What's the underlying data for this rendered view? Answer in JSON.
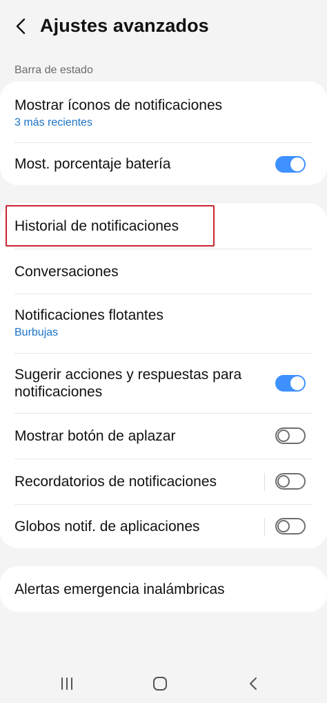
{
  "header": {
    "title": "Ajustes avanzados",
    "back_icon": "chevron-left-icon"
  },
  "status_bar_section": {
    "label": "Barra de estado",
    "items": [
      {
        "title": "Mostrar íconos de notificaciones",
        "subtitle": "3 más recientes"
      },
      {
        "title": "Most. porcentaje batería",
        "toggle": true
      }
    ]
  },
  "notifications_section": {
    "items": [
      {
        "title": "Historial de notificaciones",
        "highlighted": true
      },
      {
        "title": "Conversaciones"
      },
      {
        "title": "Notificaciones flotantes",
        "subtitle": "Burbujas"
      },
      {
        "title_line1": "Sugerir acciones y respuestas para",
        "title_line2": "notificaciones",
        "toggle": true
      },
      {
        "title": "Mostrar botón de aplazar",
        "toggle": false
      },
      {
        "title": "Recordatorios de notificaciones",
        "toggle": false
      },
      {
        "title": "Globos notif. de aplicaciones",
        "toggle": false
      }
    ]
  },
  "emergency_section": {
    "items": [
      {
        "title": "Alertas emergencia inalámbricas"
      }
    ]
  },
  "navbar": {
    "recents_icon": "recents-icon",
    "home_icon": "home-icon",
    "back_icon": "back-icon"
  },
  "colors": {
    "background": "#f4f4f4",
    "card": "#ffffff",
    "accent": "#3e91ff",
    "link_subtitle": "#1a73c6",
    "highlight_border": "#c8242f"
  }
}
